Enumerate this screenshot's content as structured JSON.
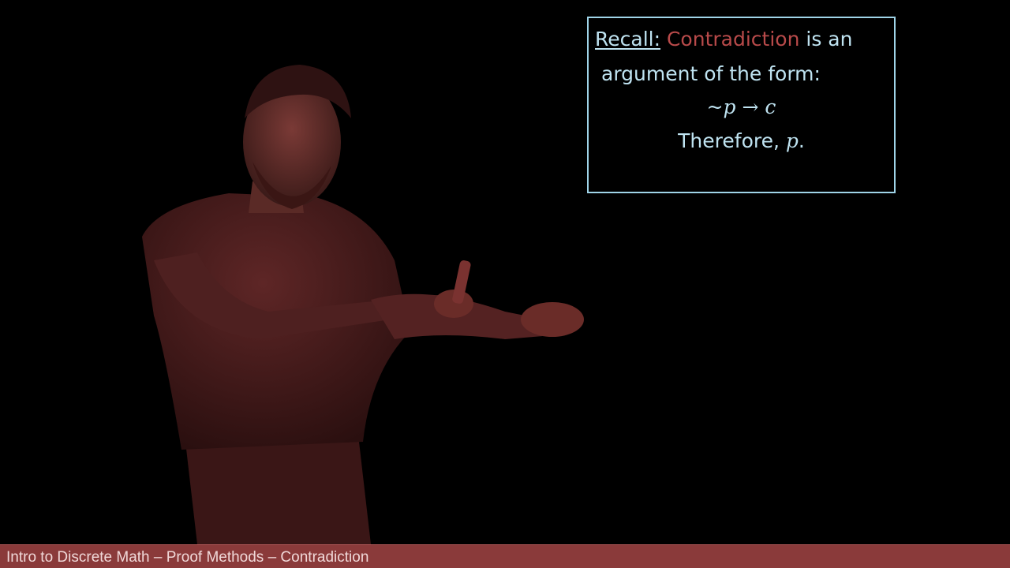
{
  "recall": {
    "label": "Recall:",
    "term": "Contradiction",
    "line1_rest": " is an",
    "line2": "argument of the form:",
    "formula": "~p → c",
    "conclusion_prefix": "Therefore, ",
    "conclusion_var": "p",
    "conclusion_suffix": "."
  },
  "footer": {
    "title": "Intro to Discrete Math – Proof Methods – Contradiction"
  },
  "colors": {
    "background": "#000000",
    "box_border": "#9fd4e8",
    "box_text": "#bfe3f1",
    "term_highlight": "#b84a4a",
    "footer_bar": "#8a3a3a",
    "presenter_tint": "#6a2a2a"
  }
}
